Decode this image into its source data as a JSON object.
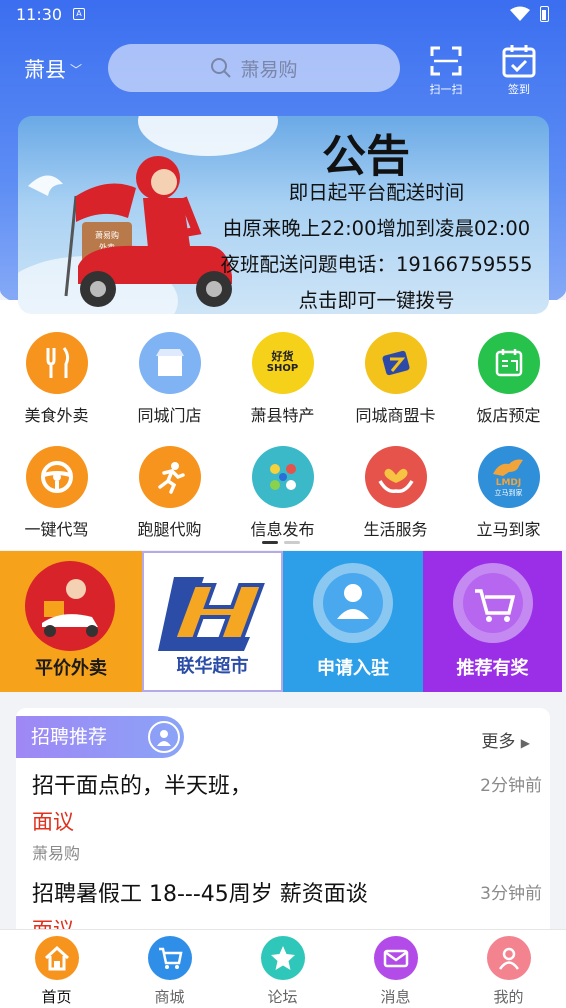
{
  "status_bar": {
    "time": "11:30",
    "a_icon": "A"
  },
  "header": {
    "city": "萧县",
    "search_placeholder": "萧易购",
    "scan_label": "扫一扫",
    "signin_label": "签到"
  },
  "banner": {
    "title": "公告",
    "lines": [
      "即日起平台配送时间",
      "由原来晚上22:00增加到凌晨02:00",
      "夜班配送问题电话：19166759555",
      "点击即可一键拨号"
    ],
    "box_text": [
      "萧易购",
      "外卖"
    ]
  },
  "categories": [
    {
      "label": "美食外卖",
      "icon": "food-icon",
      "color": "#f7941d"
    },
    {
      "label": "同城门店",
      "icon": "store-icon",
      "color": "#7fb3f4"
    },
    {
      "label": "萧县特产",
      "icon": "specialty-icon",
      "color": "#f5d11a",
      "badge": [
        "好货",
        "SHOP"
      ]
    },
    {
      "label": "同城商盟卡",
      "icon": "card-icon",
      "color": "#f3c21b"
    },
    {
      "label": "饭店预定",
      "icon": "reservation-icon",
      "color": "#27c24c"
    },
    {
      "label": "一键代驾",
      "icon": "steering-wheel-icon",
      "color": "#f7941d"
    },
    {
      "label": "跑腿代购",
      "icon": "runner-icon",
      "color": "#f7941d"
    },
    {
      "label": "信息发布",
      "icon": "info-publish-icon",
      "color": "#3bb9c9"
    },
    {
      "label": "生活服务",
      "icon": "life-service-icon",
      "color": "#e5534b"
    },
    {
      "label": "立马到家",
      "icon": "horse-icon",
      "color": "#2f8fd9",
      "badge": [
        "LMDJ",
        "立马到家"
      ]
    }
  ],
  "promos": [
    {
      "label": "平价外卖",
      "bg": "#f7a21b",
      "text_color": "#1a1a1a"
    },
    {
      "label": "联华超市",
      "bg": "#ffffff",
      "text_color": "#2b4da8"
    },
    {
      "label": "申请入驻",
      "bg": "#2d9ee8",
      "text_color": "#ffffff"
    },
    {
      "label": "推荐有奖",
      "bg": "#9b2fe8",
      "text_color": "#ffffff"
    }
  ],
  "recruit": {
    "tag": "招聘推荐",
    "more": "更多",
    "jobs": [
      {
        "title": "招干面点的，半天班，",
        "time": "2分钟前",
        "salary": "面议",
        "source": "萧易购"
      },
      {
        "title": "招聘暑假工 18---45周岁 薪资面谈",
        "time": "3分钟前",
        "salary": "面议",
        "source": ""
      }
    ]
  },
  "nav": [
    {
      "label": "首页",
      "icon": "home-icon",
      "color": "#f7941d",
      "active": true
    },
    {
      "label": "商城",
      "icon": "cart-icon",
      "color": "#2f8fe8",
      "active": false
    },
    {
      "label": "论坛",
      "icon": "star-icon",
      "color": "#2fc7b9",
      "active": false
    },
    {
      "label": "消息",
      "icon": "mail-icon",
      "color": "#b24be8",
      "active": false
    },
    {
      "label": "我的",
      "icon": "profile-icon",
      "color": "#f2838f",
      "active": false
    }
  ],
  "colors": {
    "primary_blue": "#3b6ef0",
    "salary_red": "#e0301e"
  }
}
